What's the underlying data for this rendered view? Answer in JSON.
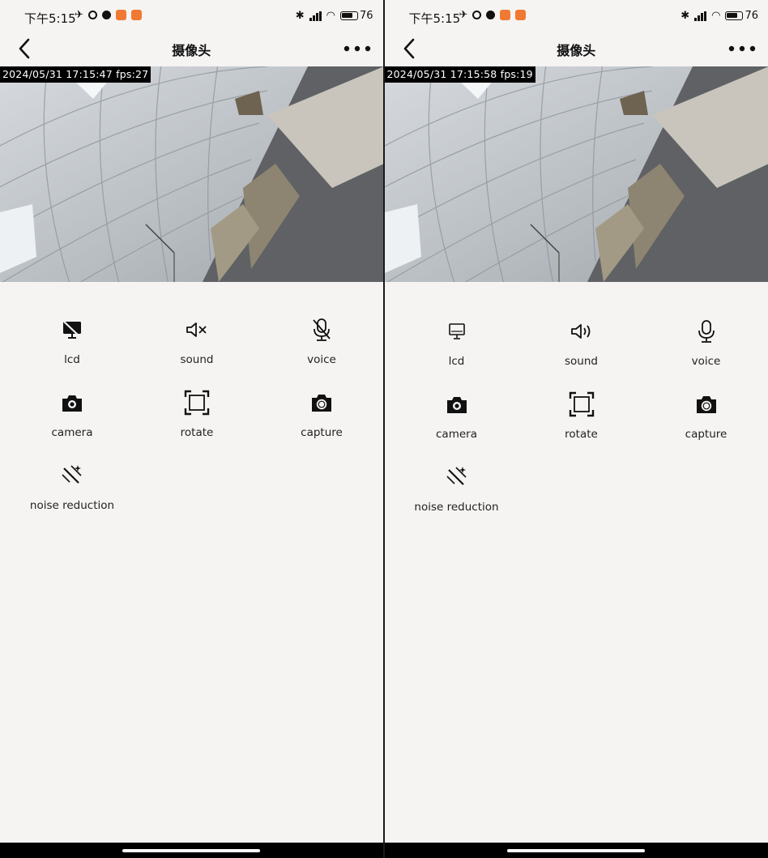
{
  "screens": [
    {
      "status": {
        "time": "下午5:15",
        "battery": "76"
      },
      "nav": {
        "title": "摄像头"
      },
      "video": {
        "osd": "2024/05/31 17:15:47  fps:27"
      },
      "controls": [
        {
          "label": "lcd",
          "icon": "lcd-off-icon"
        },
        {
          "label": "sound",
          "icon": "sound-muted-icon"
        },
        {
          "label": "voice",
          "icon": "mic-off-icon"
        },
        {
          "label": "camera",
          "icon": "camera-icon"
        },
        {
          "label": "rotate",
          "icon": "rotate-icon"
        },
        {
          "label": "capture",
          "icon": "capture-icon"
        },
        {
          "label": "noise reduction",
          "icon": "magic-wand-icon"
        }
      ]
    },
    {
      "status": {
        "time": "下午5:15",
        "battery": "76"
      },
      "nav": {
        "title": "摄像头"
      },
      "video": {
        "osd": "2024/05/31 17:15:58  fps:19"
      },
      "controls": [
        {
          "label": "lcd",
          "icon": "lcd-on-icon"
        },
        {
          "label": "sound",
          "icon": "sound-on-icon"
        },
        {
          "label": "voice",
          "icon": "mic-on-icon"
        },
        {
          "label": "camera",
          "icon": "camera-icon"
        },
        {
          "label": "rotate",
          "icon": "rotate-icon"
        },
        {
          "label": "capture",
          "icon": "capture-icon"
        },
        {
          "label": "noise reduction",
          "icon": "magic-wand-icon"
        }
      ]
    }
  ]
}
